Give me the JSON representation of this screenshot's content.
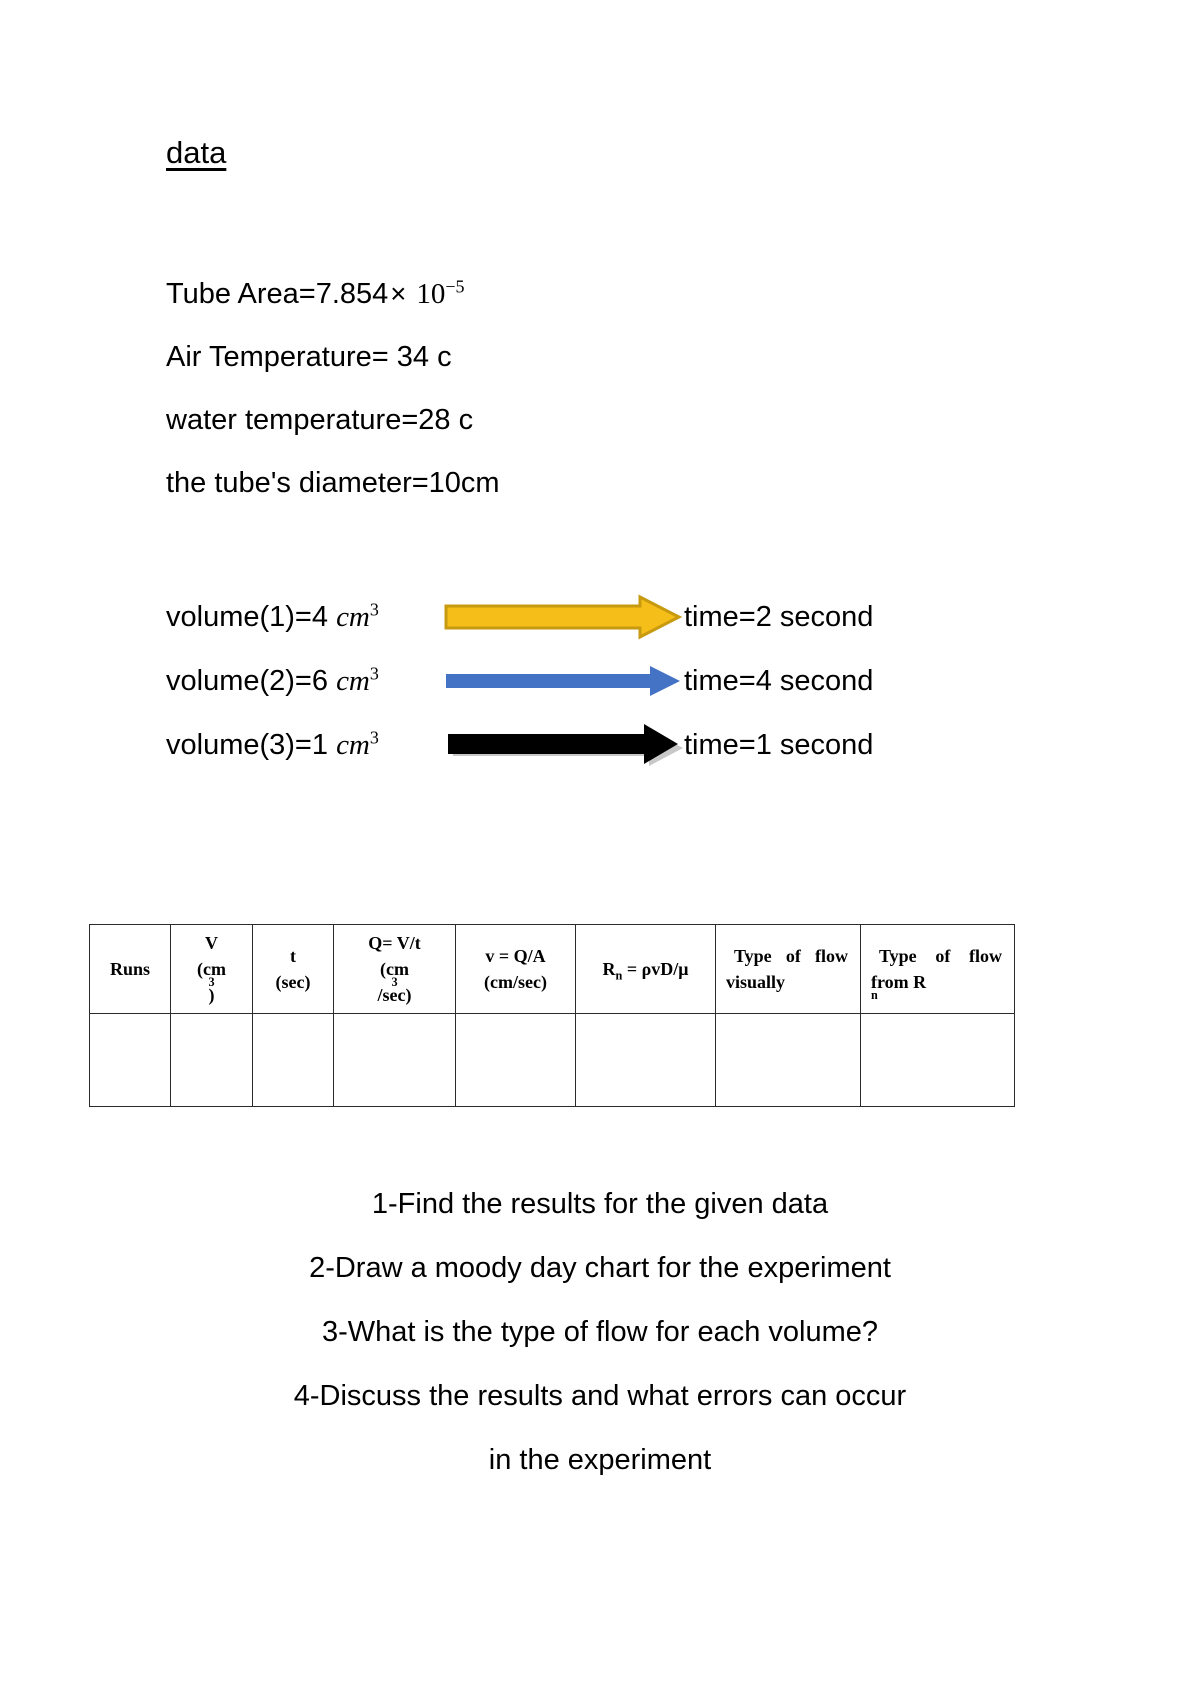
{
  "document": {
    "title": "data"
  },
  "parameters": [
    {
      "label": "Tube Area=",
      "value": "7.854",
      "times": "×",
      "base": "10",
      "exponent": "−5"
    },
    {
      "label": "Air Temperature= 34 c"
    },
    {
      "label": "water temperature=28 c"
    },
    {
      "label": "the tube's diameter=10cm"
    }
  ],
  "param_text": {
    "tube_area_prefix": "Tube Area=",
    "tube_area_value": "7.854",
    "tube_area_times": "×",
    "tube_area_base": "10",
    "tube_area_exp": "−5",
    "air_temperature": "Air Temperature= 34 c",
    "water_temperature": "water temperature=28 c",
    "tube_diameter": "the tube's diameter=10cm"
  },
  "volume_rows": [
    {
      "label": "volume(1)=4 ",
      "unit": "cm",
      "unit_exp": "3",
      "time": "time=2 second",
      "arrow_color": "#F5BE18",
      "arrow_stroke": "#C79A10",
      "arrow_style": "thick-outlined"
    },
    {
      "label": "volume(2)=6 ",
      "unit": "cm",
      "unit_exp": "3",
      "time": "time=4 second",
      "arrow_color": "#4472C4",
      "arrow_stroke": "#4472C4",
      "arrow_style": "thin-solid"
    },
    {
      "label": "volume(3)=1 ",
      "unit": "cm",
      "unit_exp": "3",
      "time": "time=1 second",
      "arrow_color": "#000000",
      "arrow_stroke": "#000000",
      "arrow_style": "thin-solid-shadow"
    }
  ],
  "table": {
    "headers": [
      {
        "line1": "Runs",
        "line2": ""
      },
      {
        "line1": "V",
        "line2": "(cm³)"
      },
      {
        "line1": "t",
        "line2": "(sec)"
      },
      {
        "line1": "Q= V/t",
        "line2": "(cm³/sec)"
      },
      {
        "line1": "v = Q/A",
        "line2": "(cm/sec)"
      },
      {
        "line1": "Rₙ = ρvD/μ",
        "line2": ""
      },
      {
        "line1": "Type of flow",
        "line2": "visually"
      },
      {
        "line1": "Type of flow",
        "line2": "from Rₙ"
      }
    ],
    "header_parts": {
      "runs": "Runs",
      "v": "V",
      "v_unit": "(cm",
      "v_unit_sup": "3",
      "v_unit_close": ")",
      "t": "t",
      "t_unit": "(sec)",
      "q": "Q= V/t",
      "q_unit_a": "(cm",
      "q_unit_sup": "3",
      "q_unit_b": "/sec)",
      "vel": "v = Q/A",
      "vel_unit": "(cm/sec)",
      "rn_prefix": "R",
      "rn_sub": "n",
      "rn_rest": " = ρvD/μ",
      "flow_visual_l1": "Type of flow",
      "flow_visual_l2": "visually",
      "flow_rn_l1": "Type of flow",
      "flow_rn_l2_prefix": "from R",
      "flow_rn_l2_sub": "n"
    },
    "rows": [
      [
        "",
        "",
        "",
        "",
        "",
        "",
        "",
        ""
      ]
    ]
  },
  "questions": [
    "1-Find the results for the given data",
    "2-Draw a moody day chart for the experiment",
    "3-What is the type of flow for each volume?",
    "4-Discuss the results and what errors can occur",
    "in the experiment"
  ],
  "colors": {
    "yellow_fill": "#F5BE18",
    "yellow_stroke": "#C79A10",
    "blue": "#4472C4",
    "black": "#000000",
    "table_border": "#2b2b2b",
    "page_background": "#ffffff"
  }
}
